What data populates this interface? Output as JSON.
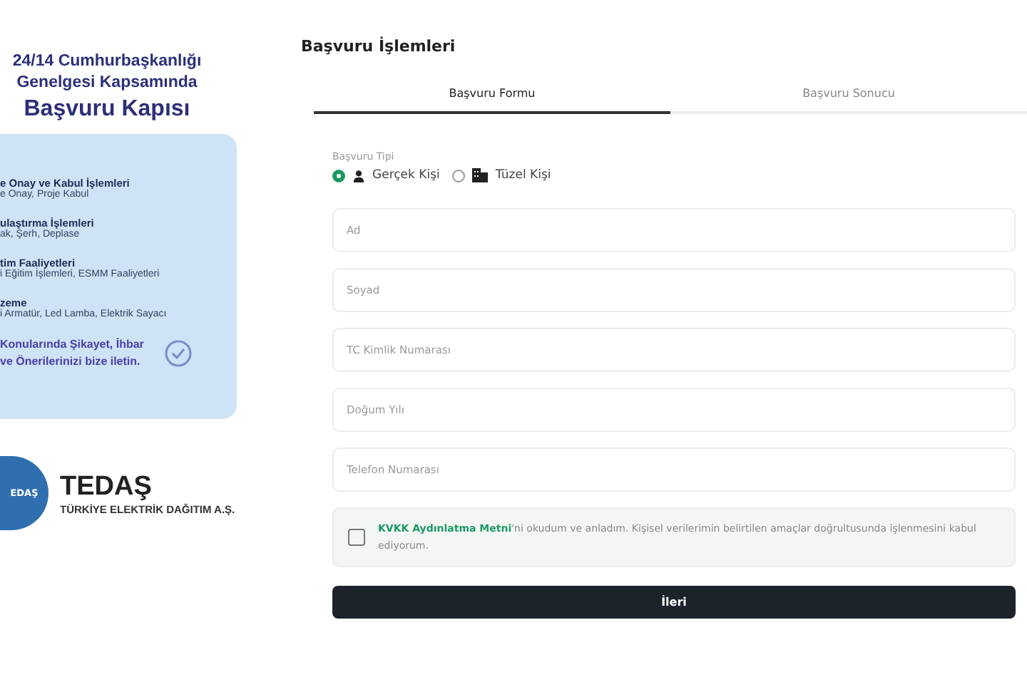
{
  "banner": {
    "title_lines": [
      "24/14 Cumhurbaşkanlığı",
      "Genelgesi Kapsamında"
    ],
    "subtitle": "Başvuru Kapısı",
    "items": [
      {
        "heading": "e Onay ve Kabul İşlemleri",
        "detail": "e Onay, Proje Kabul"
      },
      {
        "heading": "ulaştırma İşlemleri",
        "detail": "ak, Şerh, Deplase"
      },
      {
        "heading": "tim Faaliyetleri",
        "detail": "i Eğitim İşlemleri, ESMM Faaliyetleri"
      },
      {
        "heading": "zeme",
        "detail": "i Armatür, Led Lamba, Elektrik Sayacı"
      }
    ],
    "note_lines": [
      "Konularında  Şikayet, İhbar",
      "ve Önerilerinizi bize iletin."
    ]
  },
  "logo": {
    "badge": "EDAŞ",
    "name": "TEDAŞ",
    "full_name": "TÜRKİYE ELEKTRİK DAĞITIM A.Ş."
  },
  "page_title": "Başvuru İşlemleri",
  "tabs": [
    {
      "label": "Başvuru Formu",
      "selected": true
    },
    {
      "label": "Başvuru Sonucu",
      "selected": false
    }
  ],
  "applicant_type": {
    "label": "Başvuru Tipi",
    "options": [
      {
        "label": "Gerçek Kişi",
        "kind": "person",
        "selected": true
      },
      {
        "label": "Tüzel Kişi",
        "kind": "building",
        "selected": false
      }
    ]
  },
  "fields": [
    {
      "placeholder": "Ad"
    },
    {
      "placeholder": "Soyad"
    },
    {
      "placeholder": "TC Kimlik Numarası"
    },
    {
      "placeholder": "Doğum Yılı"
    },
    {
      "placeholder": "Telefon Numarası"
    }
  ],
  "consent": {
    "text": "**KVKK Aydınlatma Metni**'ni okudum ve anladım. Kişisel verilerimin belirtilen amaçlar doğrultusunda işlenmesini kabul ediyorum.",
    "checked": false
  },
  "submit": "İleri"
}
